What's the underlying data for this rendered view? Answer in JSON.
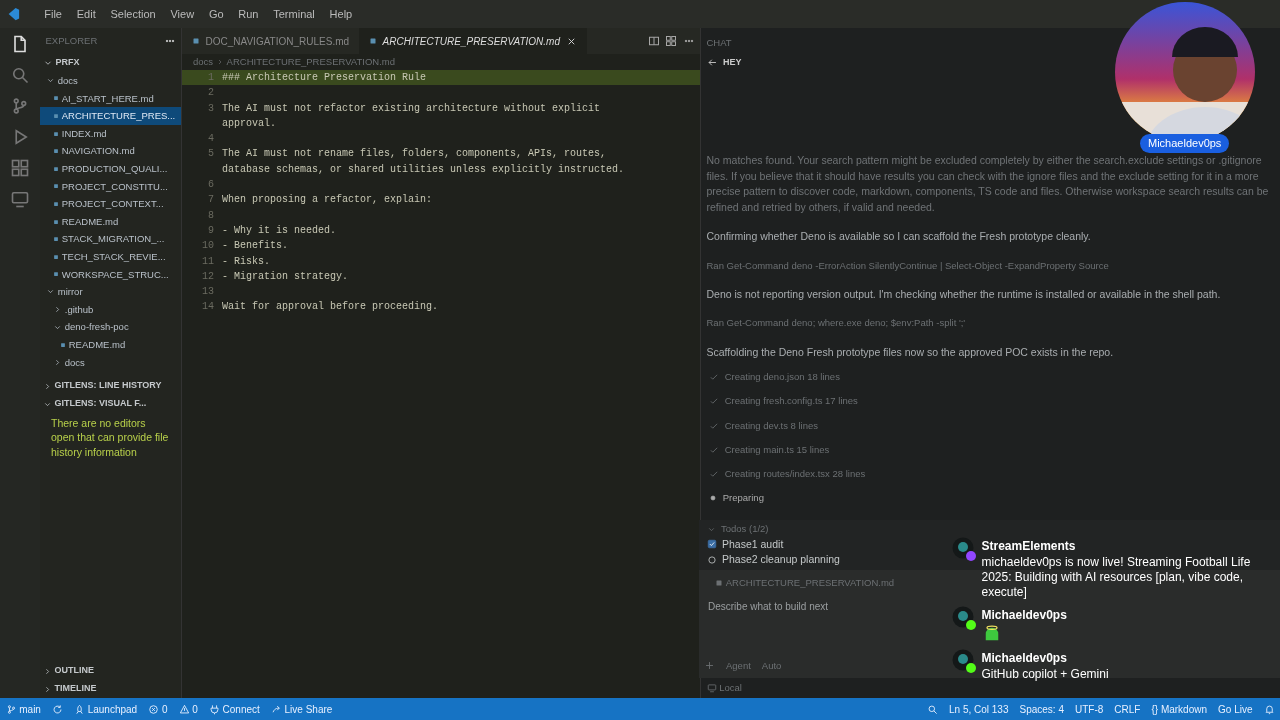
{
  "menu": [
    "File",
    "Edit",
    "Selection",
    "View",
    "Go",
    "Run",
    "Terminal",
    "Help"
  ],
  "explorer": {
    "title": "EXPLORER",
    "root": "PRFX",
    "tree": [
      {
        "label": "docs",
        "expanded": true,
        "selected": false,
        "children": [
          {
            "label": "AI_START_HERE.md",
            "selected": false
          },
          {
            "label": "ARCHITECTURE_PRES...",
            "selected": true
          },
          {
            "label": "INDEX.md",
            "selected": false
          },
          {
            "label": "NAVIGATION.md",
            "selected": false
          },
          {
            "label": "PRODUCTION_QUALI...",
            "selected": false
          },
          {
            "label": "PROJECT_CONSTITU...",
            "selected": false
          },
          {
            "label": "PROJECT_CONTEXT...",
            "selected": false
          },
          {
            "label": "README.md",
            "selected": false
          },
          {
            "label": "STACK_MIGRATION_...",
            "selected": false
          },
          {
            "label": "TECH_STACK_REVIE...",
            "selected": false
          },
          {
            "label": "WORKSPACE_STRUC...",
            "selected": false
          }
        ]
      },
      {
        "label": "mirror",
        "expanded": true,
        "selected": false,
        "children": [
          {
            "label": ".github",
            "expanded": false,
            "selected": false
          },
          {
            "label": "deno-fresh-poc",
            "expanded": true,
            "selected": false,
            "children": [
              {
                "label": "README.md",
                "selected": false
              }
            ]
          },
          {
            "label": "docs",
            "expanded": false,
            "selected": false
          }
        ]
      }
    ]
  },
  "sections": [
    {
      "label": "GITLENS: LINE HISTORY",
      "expanded": false
    },
    {
      "label": "GITLENS: VISUAL F...",
      "expanded": true,
      "message": "There are no editors open that can provide file history information"
    }
  ],
  "bottom_sections": [
    {
      "label": "OUTLINE",
      "expanded": false
    },
    {
      "label": "TIMELINE",
      "expanded": false
    }
  ],
  "tabs": [
    {
      "label": "DOC_NAVIGATION_RULES.md",
      "selected": false
    },
    {
      "label": "ARCHITECTURE_PRESERVATION.md",
      "selected": true
    }
  ],
  "breadcrumb": [
    "docs",
    "ARCHITECTURE_PRESERVATION.md"
  ],
  "editor": {
    "lines": [
      {
        "number": "1",
        "text": "### Architecture Preservation Rule"
      },
      {
        "number": "2"
      },
      {
        "number": "3",
        "text": "The AI must not refactor existing architecture without explicit approval."
      },
      {
        "number": "4"
      },
      {
        "number": "5",
        "text": "The AI must not rename files, folders, components, APIs, routes, database schemas, or shared utilities unless explicitly instructed."
      },
      {
        "number": "6"
      },
      {
        "number": "7",
        "text": "When proposing a refactor, explain:"
      },
      {
        "number": "8"
      },
      {
        "number": "9",
        "text": "- Why it is needed."
      },
      {
        "number": "10",
        "text": "- Benefits."
      },
      {
        "number": "11",
        "text": "- Risks."
      },
      {
        "number": "12",
        "text": "- Migration strategy."
      },
      {
        "number": "13"
      },
      {
        "number": "14",
        "text": "Wait for approval before proceeding."
      }
    ]
  },
  "chat": {
    "title": "CHAT",
    "session": "HEY",
    "messages": [
      {
        "kind": "text",
        "text": "No matches found. Your search pattern might be excluded completely by either the search.exclude settings or .gitignore files. If you believe that it should have results you can check with the ignore files and the exclude setting for it in a more precise pattern to discover code, markdown, components, TS code and files. Otherwise workspace search results can be refined and retried by others, if valid and needed."
      },
      {
        "kind": "text",
        "text": "Confirming whether Deno is available so I can scaffold the Fresh prototype cleanly."
      },
      {
        "kind": "tool",
        "text": "Ran Get-Command deno -ErrorAction SilentlyContinue | Select-Object -ExpandProperty Source"
      },
      {
        "kind": "text",
        "text": "Deno is not reporting version output. I'm checking whether the runtime is installed or available in the shell path."
      },
      {
        "kind": "tool",
        "text": "Ran Get-Command deno; where.exe deno; $env:Path -split ';'"
      },
      {
        "kind": "text",
        "text": "Scaffolding the Deno Fresh prototype files now so the approved POC exists in the repo."
      },
      {
        "kind": "step",
        "text": "Creating deno.json 18 lines",
        "done": true
      },
      {
        "kind": "step",
        "text": "Creating fresh.config.ts 17 lines",
        "done": true
      },
      {
        "kind": "step",
        "text": "Creating dev.ts 8 lines",
        "done": true
      },
      {
        "kind": "step",
        "text": "Creating main.ts 15 lines",
        "done": true
      },
      {
        "kind": "step",
        "text": "Creating routes/index.tsx 28 lines",
        "done": true
      },
      {
        "kind": "step",
        "text": "Preparing",
        "done": false
      }
    ],
    "todos": {
      "title": "Todos (1/2)",
      "items": [
        {
          "label": "Phase1 audit",
          "checked": true
        },
        {
          "label": "Phase2 cleanup planning",
          "checked": false
        }
      ]
    },
    "attachment": "ARCHITECTURE_PRESERVATION.md",
    "input": {
      "placeholder": "Describe what to build next"
    },
    "mode": "Agent",
    "model": "Auto",
    "target": "Local"
  },
  "stream": {
    "name": "Michaeldev0ps",
    "messages": [
      {
        "author": "StreamElements",
        "color": "#9146ff",
        "kind": "text",
        "text": "michaeldev0ps is now live! Streaming Football Life 2025: Building with AI resources [plan, vibe code, execute]"
      },
      {
        "author": "Michaeldev0ps",
        "color": "#53fc18",
        "kind": "emoji"
      },
      {
        "author": "Michaeldev0ps",
        "color": "#53fc18",
        "kind": "text",
        "text": "GitHub copilot + Gemini"
      }
    ]
  },
  "status_bar": {
    "left": [
      {
        "kind": "branch",
        "text": "main"
      },
      {
        "kind": "sync"
      },
      {
        "kind": "rocket",
        "text": "Launchpad"
      },
      {
        "kind": "error",
        "text": "0"
      },
      {
        "kind": "warning",
        "text": "0"
      },
      {
        "kind": "plug",
        "text": "Connect"
      },
      {
        "kind": "share",
        "text": "Live Share"
      }
    ],
    "right": [
      {
        "kind": "search"
      },
      {
        "kind": "plain",
        "text": "Ln 5, Col 133"
      },
      {
        "kind": "plain",
        "text": "Spaces: 4"
      },
      {
        "kind": "plain",
        "text": "UTF-8"
      },
      {
        "kind": "plain",
        "text": "CRLF"
      },
      {
        "kind": "plain",
        "text": "{} Markdown"
      },
      {
        "kind": "plain",
        "text": "Go Live"
      },
      {
        "kind": "bell"
      }
    ]
  }
}
